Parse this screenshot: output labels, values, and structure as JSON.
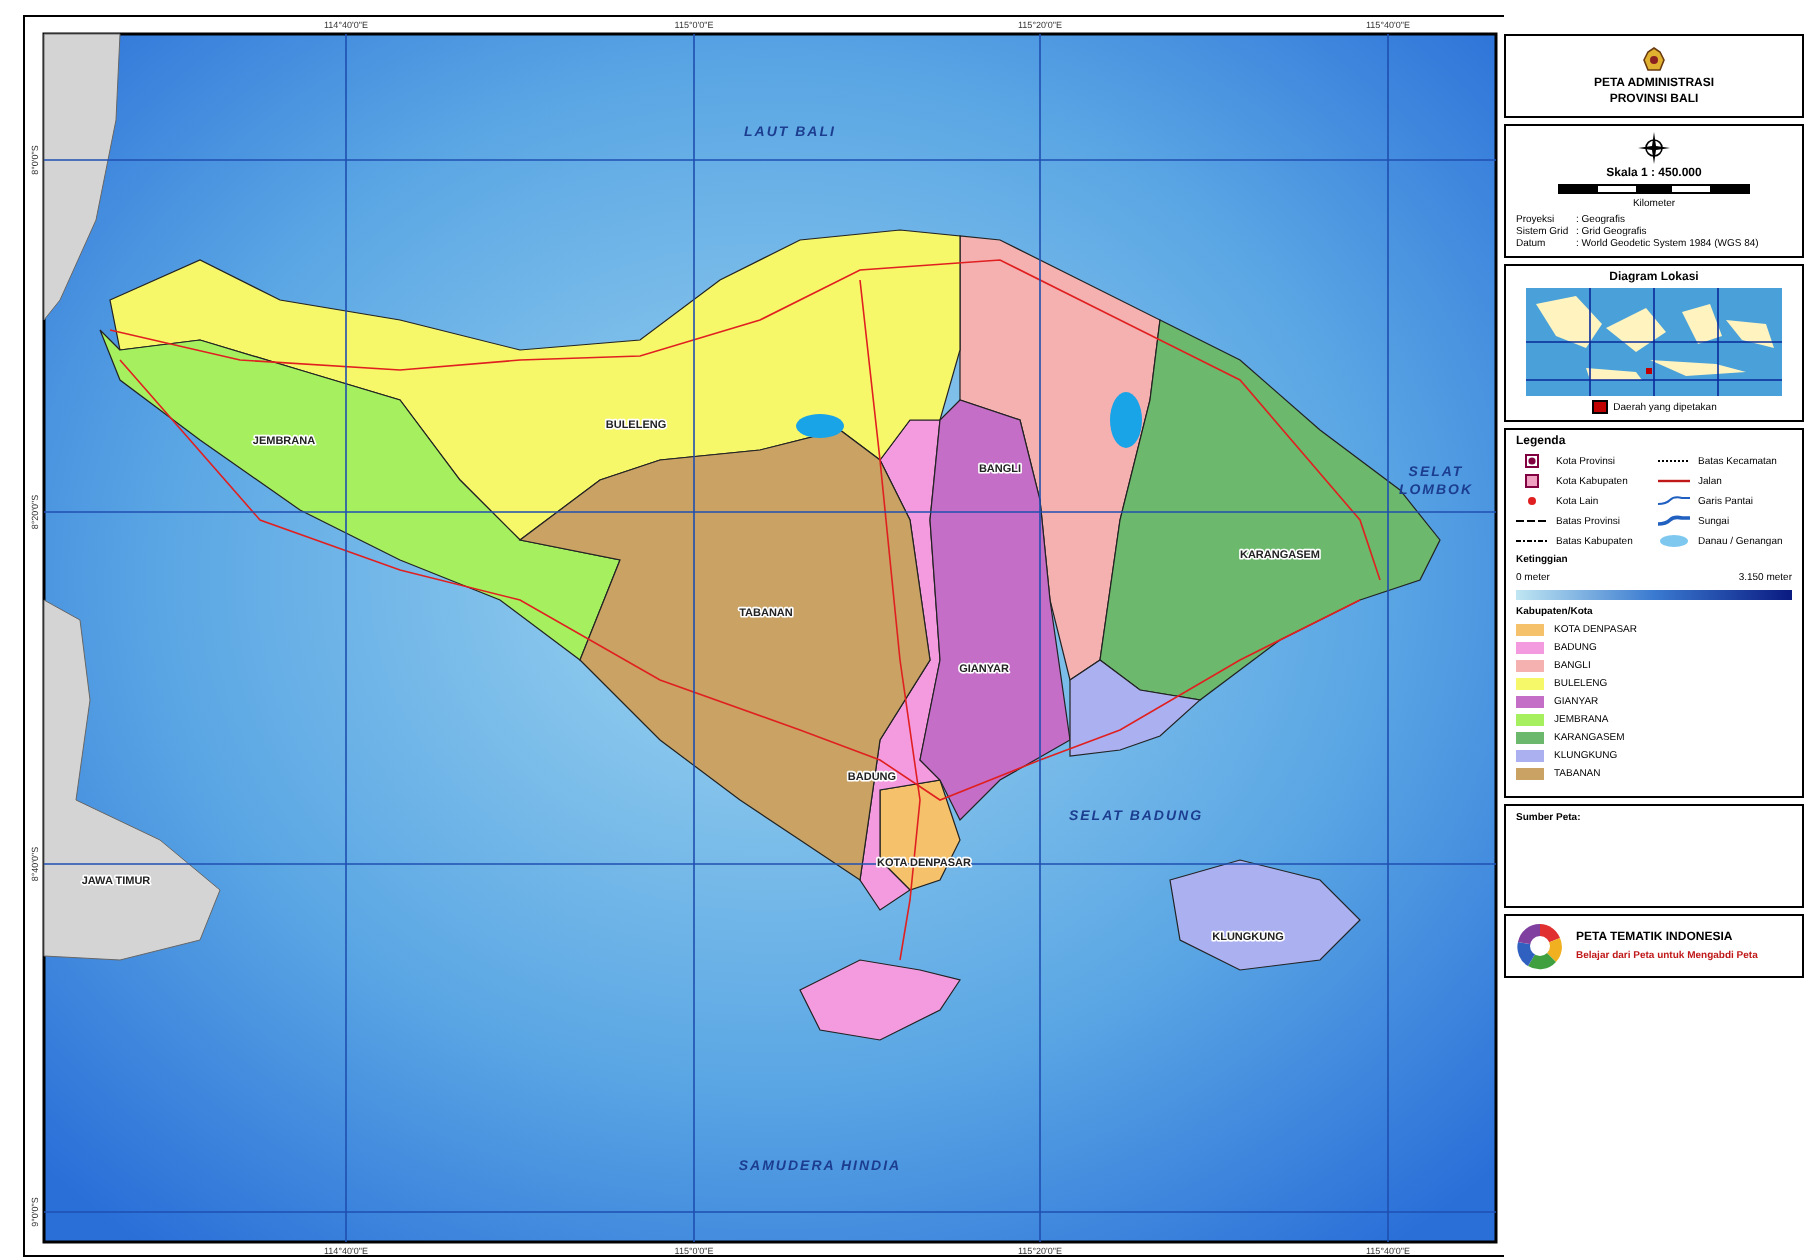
{
  "map": {
    "longitude_labels_top": [
      "114°40'0\"E",
      "115°0'0\"E",
      "115°20'0\"E",
      "115°40'0\"E"
    ],
    "longitude_labels_bottom": [
      "114°40'0\"E",
      "115°0'0\"E",
      "115°20'0\"E",
      "115°40'0\"E"
    ],
    "latitude_labels": [
      "8°0'0\"S",
      "8°20'0\"S",
      "8°40'0\"S",
      "9°0'0\"S"
    ],
    "sea_labels": [
      {
        "lines": [
          "LAUT BALI"
        ]
      },
      {
        "lines": [
          "SELAT",
          "LOMBOK"
        ]
      },
      {
        "lines": [
          "SELAT BADUNG"
        ]
      },
      {
        "lines": [
          "SAMUDERA HINDIA"
        ]
      }
    ],
    "land_labels": [
      "JAWA TIMUR"
    ],
    "regency_labels": [
      "BULELENG",
      "JEMBRANA",
      "BANGLI",
      "KARANGASEM",
      "TABANAN",
      "GIANYAR",
      "BADUNG",
      "KOTA DENPASAR",
      "KLUNGKUNG"
    ]
  },
  "title": {
    "lines": [
      "PETA ADMINISTRASI",
      "PROVINSI BALI"
    ]
  },
  "scale": {
    "text": "Skala 1 : 450.000",
    "unit": "Kilometer",
    "info": [
      {
        "label": "Proyeksi",
        "value": ": Geografis"
      },
      {
        "label": "Sistem Grid",
        "value": ": Grid Geografis"
      },
      {
        "label": "Datum",
        "value": ": World Geodetic System 1984 (WGS 84)"
      }
    ]
  },
  "location": {
    "title": "Diagram Lokasi",
    "legend": "Daerah yang dipetakan"
  },
  "legend": {
    "title": "Legenda",
    "symbols": [
      {
        "kind": "capital",
        "label": "Kota Provinsi"
      },
      {
        "kind": "district",
        "label": "Batas Kecamatan"
      },
      {
        "kind": "regency_town",
        "label": "Kota Kabupaten"
      },
      {
        "kind": "road",
        "label": "Jalan"
      },
      {
        "kind": "town",
        "label": "Kota Lain"
      },
      {
        "kind": "coast",
        "label": "Garis Pantai"
      },
      {
        "kind": "province_border",
        "label": "Batas Provinsi"
      },
      {
        "kind": "river",
        "label": "Sungai"
      },
      {
        "kind": "regency_border",
        "label": "Batas Kabupaten"
      },
      {
        "kind": "lake",
        "label": "Danau / Genangan"
      }
    ],
    "elevation_title": "Ketinggian",
    "elevation_min": "0 meter",
    "elevation_max": "3.150 meter",
    "regency_title": "Kabupaten/Kota",
    "regencies": [
      {
        "name": "KOTA DENPASAR",
        "color": "#f5c26b"
      },
      {
        "name": "BADUNG",
        "color": "#f49be0"
      },
      {
        "name": "BANGLI",
        "color": "#f5b0b0"
      },
      {
        "name": "BULELENG",
        "color": "#f7f76a"
      },
      {
        "name": "GIANYAR",
        "color": "#c46ec8"
      },
      {
        "name": "JEMBRANA",
        "color": "#a6f060"
      },
      {
        "name": "KARANGASEM",
        "color": "#6cb86c"
      },
      {
        "name": "KLUNGKUNG",
        "color": "#aab0f0"
      },
      {
        "name": "TABANAN",
        "color": "#c9a264"
      }
    ]
  },
  "source": {
    "title": "Sumber Peta:"
  },
  "publisher": {
    "name": "PETA TEMATIK INDONESIA",
    "slogan": "Belajar dari Peta untuk Mengabdi Peta"
  }
}
